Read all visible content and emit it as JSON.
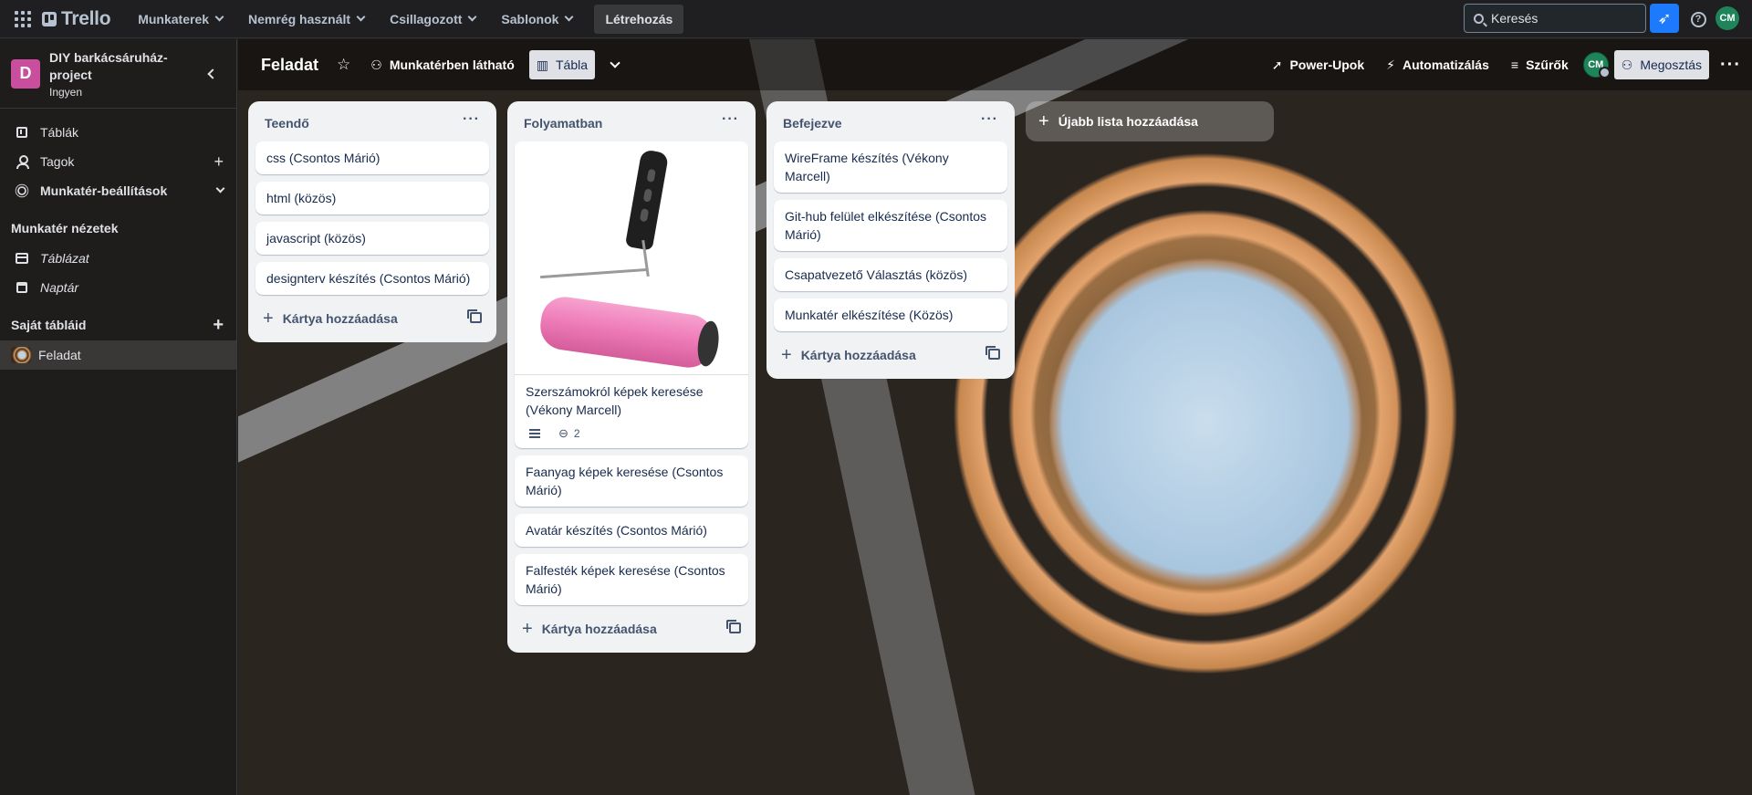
{
  "topnav": {
    "logo": "Trello",
    "menus": [
      "Munkaterek",
      "Nemrég használt",
      "Csillagozott",
      "Sablonok"
    ],
    "create": "Létrehozás",
    "search_placeholder": "Keresés",
    "avatar": "CM"
  },
  "sidebar": {
    "workspace_initial": "D",
    "workspace_name": "DIY barkácsáruház-project",
    "workspace_plan": "Ingyen",
    "items": [
      {
        "label": "Táblák"
      },
      {
        "label": "Tagok"
      },
      {
        "label": "Munkatér-beállítások"
      }
    ],
    "views_heading": "Munkatér nézetek",
    "views": [
      {
        "label": "Táblázat"
      },
      {
        "label": "Naptár"
      }
    ],
    "boards_heading": "Saját tábláid",
    "boards": [
      {
        "label": "Feladat"
      }
    ]
  },
  "board": {
    "title": "Feladat",
    "visibility": "Munkatérben látható",
    "view": "Tábla",
    "powerups": "Power-Upok",
    "automation": "Automatizálás",
    "filters": "Szűrők",
    "member_avatar": "CM",
    "share": "Megosztás",
    "add_list": "Újabb lista hozzáadása",
    "add_card": "Kártya hozzáadása",
    "lists": [
      {
        "title": "Teendő",
        "cards": [
          "css (Csontos Márió)",
          "html (közös)",
          "javascript (közös)",
          "designterv készítés (Csontos Márió)"
        ]
      },
      {
        "title": "Folyamatban",
        "cover_card": {
          "title": "Szerszámokról képek keresése (Vékony Marcell)",
          "attachments": "2"
        },
        "cards": [
          "Faanyag képek keresése (Csontos Márió)",
          "Avatár készítés (Csontos Márió)",
          "Falfesték képek keresése (Csontos Márió)"
        ]
      },
      {
        "title": "Befejezve",
        "cards": [
          "WireFrame készítés (Vékony Marcell)",
          "Git-hub felület elkészítése (Csontos Márió)",
          "Csapatvezető Választás (közös)",
          "Munkatér elkészítése (Közös)"
        ]
      }
    ]
  },
  "colors": {
    "accent": "#1d7afc",
    "workspace_icon": "#c94f9e",
    "avatar": "#1f845a"
  }
}
